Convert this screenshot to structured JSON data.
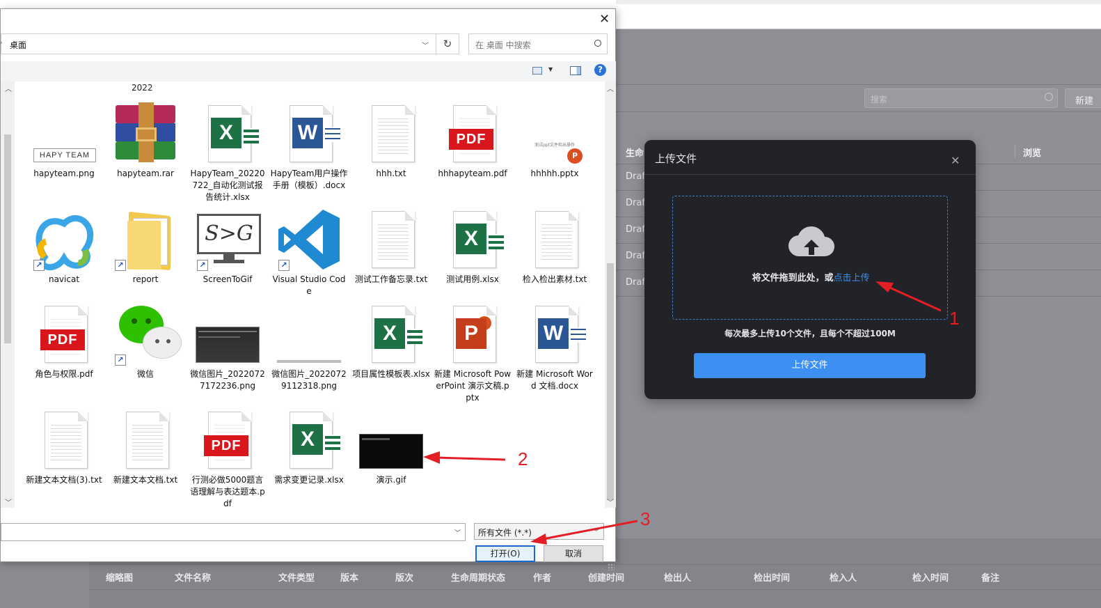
{
  "background_app": {
    "search_placeholder": "搜索",
    "new_button": "新建",
    "table_headers": {
      "lifecycle": "生命",
      "browse": "浏览"
    },
    "rows": [
      "Draf",
      "Draf",
      "Draf",
      "Draf",
      "Draf"
    ],
    "bottom_columns": [
      "缩略图",
      "文件名称",
      "文件类型",
      "版本",
      "版次",
      "生命周期状态",
      "作者",
      "创建时间",
      "检出人",
      "检出时间",
      "检入人",
      "检入时间",
      "备注"
    ]
  },
  "upload_modal": {
    "title": "上传文件",
    "close_icon": "close-icon",
    "drop_text": "将文件拖到此处，或",
    "click_upload": "点击上传",
    "limit_text": "每次最多上传10个文件，且每个不超过100M",
    "upload_button": "上传文件"
  },
  "file_dialog": {
    "address_path": "桌面",
    "search_placeholder": "在 桌面 中搜索",
    "partial_top_label": "2022",
    "files": [
      {
        "name": "hapyteam.png",
        "type": "png-logo"
      },
      {
        "name": "hapyteam.rar",
        "type": "rar"
      },
      {
        "name": "HapyTeam_20220722_自动化测试报告统计.xlsx",
        "type": "xlsx"
      },
      {
        "name": "HapyTeam用户操作手册（模板）.docx",
        "type": "docx"
      },
      {
        "name": "hhh.txt",
        "type": "txt"
      },
      {
        "name": "hhhapyteam.pdf",
        "type": "pdf"
      },
      {
        "name": "hhhhh.pptx",
        "type": "pptx-thumb"
      },
      {
        "name": "navicat",
        "type": "navicat"
      },
      {
        "name": "report",
        "type": "folder"
      },
      {
        "name": "ScreenToGif",
        "type": "screentogif"
      },
      {
        "name": "Visual Studio Code",
        "type": "vscode"
      },
      {
        "name": "测试工作备忘录.txt",
        "type": "txt"
      },
      {
        "name": "测试用例.xlsx",
        "type": "xlsx"
      },
      {
        "name": "检入检出素材.txt",
        "type": "txt"
      },
      {
        "name": "角色与权限.pdf",
        "type": "pdf"
      },
      {
        "name": "微信",
        "type": "wechat"
      },
      {
        "name": "微信图片_20220727172236.png",
        "type": "screenshot"
      },
      {
        "name": "微信图片_20220729112318.png",
        "type": "blank-png"
      },
      {
        "name": "项目属性模板表.xlsx",
        "type": "xlsx"
      },
      {
        "name": "新建 Microsoft PowerPoint 演示文稿.pptx",
        "type": "pptx"
      },
      {
        "name": "新建 Microsoft Word 文档.docx",
        "type": "docx"
      },
      {
        "name": "新建文本文档(3).txt",
        "type": "txt"
      },
      {
        "name": "新建文本文档.txt",
        "type": "txt"
      },
      {
        "name": "行测必做5000题言语理解与表达题本.pdf",
        "type": "pdf"
      },
      {
        "name": "需求变更记录.xlsx",
        "type": "xlsx"
      },
      {
        "name": "演示.gif",
        "type": "gif"
      }
    ],
    "file_filter": "所有文件 (*.*)",
    "open_button": "打开(O)",
    "cancel_button": "取消",
    "logo_text": "HAPY TEAM",
    "pptx_thumb_text": "测试ppt文件检出操作"
  },
  "annotations": {
    "step1": "1",
    "step2": "2",
    "step3": "3",
    "color": "#e31e24"
  },
  "colors": {
    "accent_blue": "#3d8ff2",
    "modal_bg": "#222328",
    "link_blue": "#3c8ef0"
  }
}
